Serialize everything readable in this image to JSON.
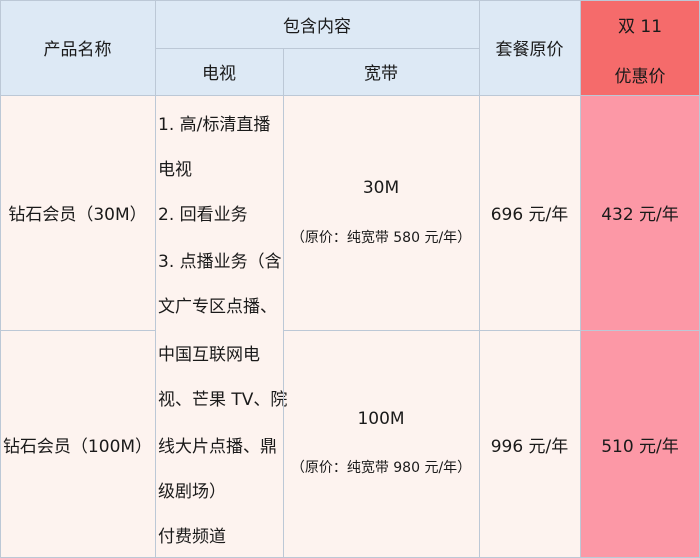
{
  "header": {
    "product_name": "产品名称",
    "contents": "包含内容",
    "tv": "电视",
    "broadband": "宽带",
    "package_price": "套餐原价",
    "promo_line1": "双 11",
    "promo_line2": "优惠价"
  },
  "tv_description_lines": [
    "1. 高/标清直播",
    "电视",
    "2. 回看业务",
    "3. 点播业务（含",
    "文广专区点播、",
    "中国互联网电",
    "视、芒果 TV、院",
    "线大片点播、鼎",
    "级剧场）",
    "付费频道"
  ],
  "rows": [
    {
      "product": "钻石会员（30M）",
      "speed": "30M",
      "broadband_note": "（原价：纯宽带 580 元/年）",
      "package_price": "696 元/年",
      "promo_price": "432 元/年"
    },
    {
      "product": "钻石会员（100M）",
      "speed": "100M",
      "broadband_note": "（原价：纯宽带 980 元/年）",
      "package_price": "996 元/年",
      "promo_price": "510 元/年"
    }
  ],
  "colors": {
    "header_bg": "#dde9f5",
    "body_bg": "#fdf3ef",
    "promo_header_bg": "#f56b6b",
    "promo_body_bg": "#fc98a6",
    "grid_line": "#bcc8d6"
  }
}
